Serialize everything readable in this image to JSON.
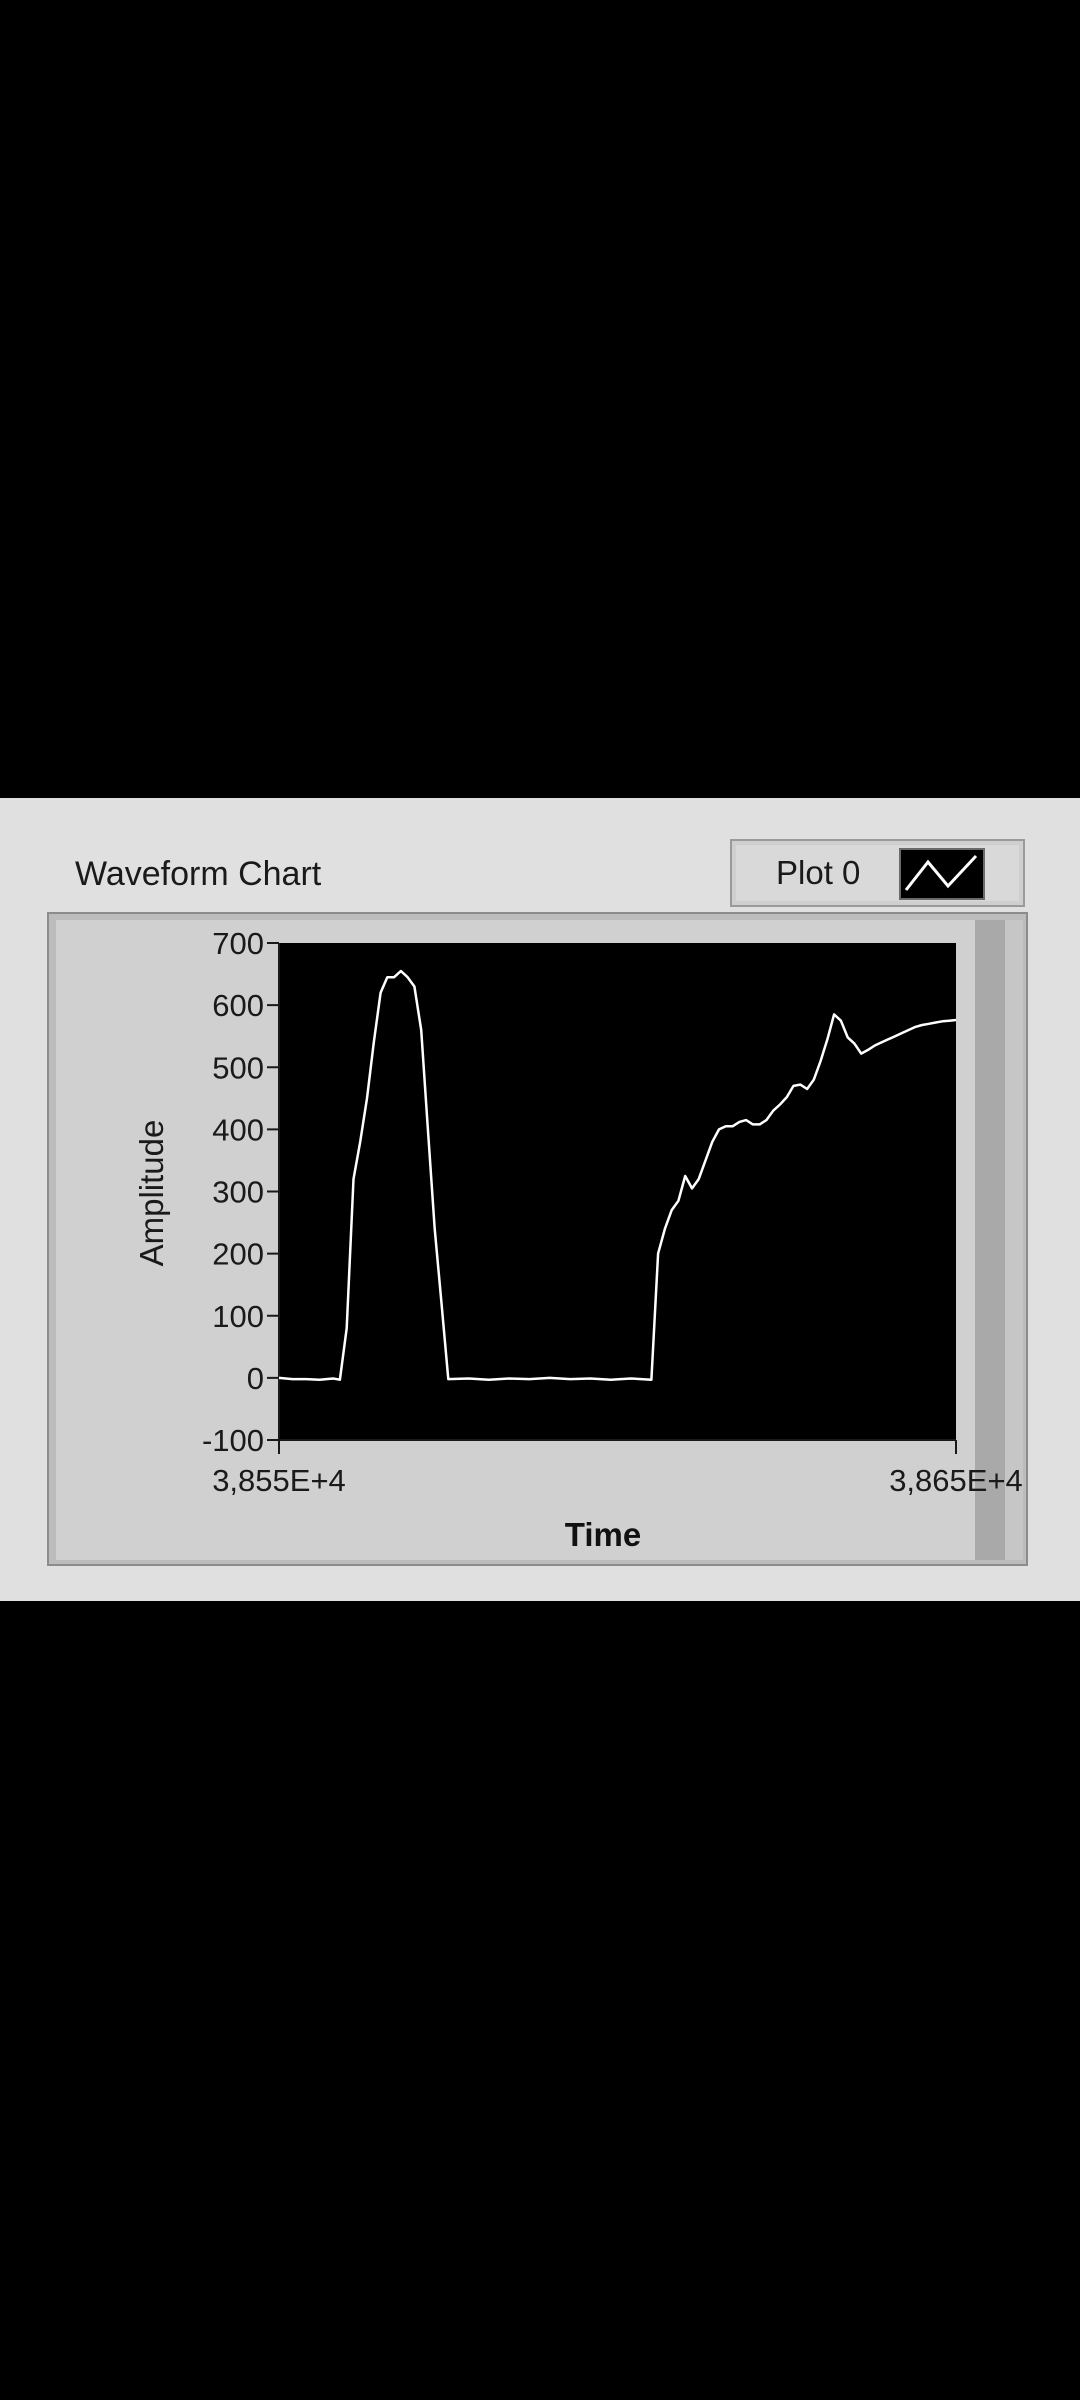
{
  "chart_data": {
    "type": "line",
    "title": "Waveform Chart",
    "xlabel": "Time",
    "ylabel": "Amplitude",
    "xlim": [
      38550,
      38650
    ],
    "ylim": [
      -100,
      700
    ],
    "xtick_labels": [
      "3,855E+4",
      "3,865E+4"
    ],
    "ytick_labels": [
      "700",
      "600",
      "500",
      "400",
      "300",
      "200",
      "100",
      "0",
      "-100"
    ],
    "yticks": [
      700,
      600,
      500,
      400,
      300,
      200,
      100,
      0,
      -100
    ],
    "grid": false,
    "legend_position": "top-right",
    "series": [
      {
        "name": "Plot 0",
        "color": "#ffffff",
        "points": [
          [
            38550,
            0
          ],
          [
            38552,
            -2
          ],
          [
            38554,
            -2
          ],
          [
            38556,
            -3
          ],
          [
            38558,
            -1
          ],
          [
            38559,
            -3
          ],
          [
            38560,
            80
          ],
          [
            38561,
            320
          ],
          [
            38562,
            380
          ],
          [
            38563,
            450
          ],
          [
            38564,
            540
          ],
          [
            38565,
            620
          ],
          [
            38566,
            645
          ],
          [
            38567,
            645
          ],
          [
            38568,
            655
          ],
          [
            38569,
            645
          ],
          [
            38570,
            630
          ],
          [
            38571,
            560
          ],
          [
            38572,
            400
          ],
          [
            38573,
            240
          ],
          [
            38574,
            120
          ],
          [
            38575,
            -2
          ],
          [
            38578,
            -1
          ],
          [
            38581,
            -3
          ],
          [
            38584,
            -1
          ],
          [
            38587,
            -2
          ],
          [
            38590,
            0
          ],
          [
            38593,
            -2
          ],
          [
            38596,
            -1
          ],
          [
            38599,
            -3
          ],
          [
            38602,
            -1
          ],
          [
            38605,
            -3
          ],
          [
            38606,
            200
          ],
          [
            38607,
            240
          ],
          [
            38608,
            270
          ],
          [
            38609,
            285
          ],
          [
            38610,
            325
          ],
          [
            38611,
            305
          ],
          [
            38612,
            320
          ],
          [
            38613,
            350
          ],
          [
            38614,
            380
          ],
          [
            38615,
            400
          ],
          [
            38616,
            405
          ],
          [
            38617,
            405
          ],
          [
            38618,
            412
          ],
          [
            38619,
            415
          ],
          [
            38620,
            408
          ],
          [
            38621,
            408
          ],
          [
            38622,
            415
          ],
          [
            38623,
            430
          ],
          [
            38624,
            440
          ],
          [
            38625,
            452
          ],
          [
            38626,
            470
          ],
          [
            38627,
            472
          ],
          [
            38628,
            465
          ],
          [
            38629,
            480
          ],
          [
            38630,
            510
          ],
          [
            38631,
            545
          ],
          [
            38632,
            585
          ],
          [
            38633,
            575
          ],
          [
            38634,
            548
          ],
          [
            38635,
            538
          ],
          [
            38636,
            522
          ],
          [
            38637,
            528
          ],
          [
            38638,
            535
          ],
          [
            38639,
            540
          ],
          [
            38640,
            545
          ],
          [
            38641,
            550
          ],
          [
            38642,
            555
          ],
          [
            38643,
            560
          ],
          [
            38644,
            565
          ],
          [
            38645,
            568
          ],
          [
            38646,
            570
          ],
          [
            38647,
            572
          ],
          [
            38648,
            574
          ],
          [
            38649,
            575
          ],
          [
            38650,
            576
          ]
        ]
      }
    ]
  }
}
